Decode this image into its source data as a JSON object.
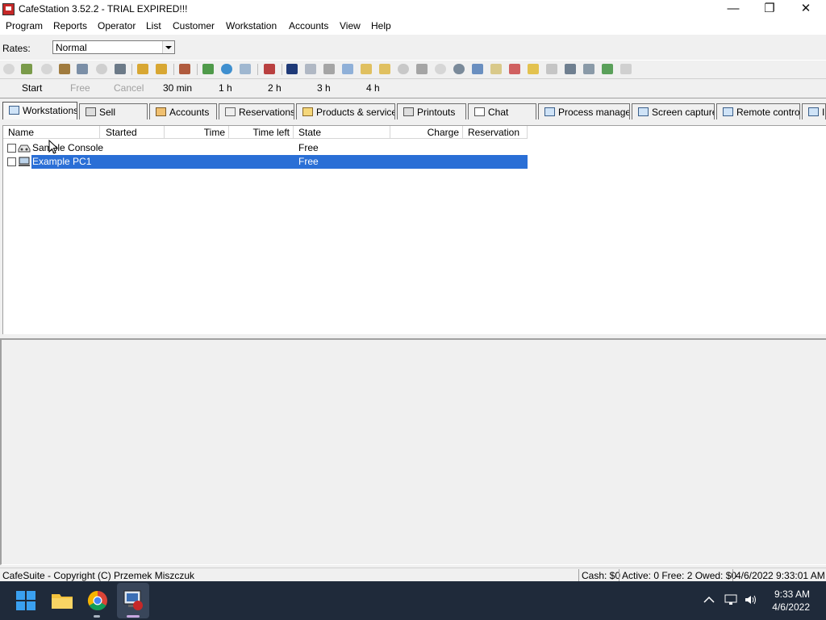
{
  "window": {
    "title": "CafeStation 3.52.2 - TRIAL EXPIRED!!!",
    "controls": [
      "—",
      "❐",
      "✕"
    ]
  },
  "menu": [
    "Program",
    "Reports",
    "Operator",
    "List",
    "Customer",
    "Workstation",
    "Accounts",
    "View",
    "Help"
  ],
  "rates": {
    "label": "Rates:",
    "value": "Normal"
  },
  "quick_actions": [
    {
      "label": "Start",
      "enabled": true
    },
    {
      "label": "Free",
      "enabled": false
    },
    {
      "label": "Cancel",
      "enabled": false
    },
    {
      "label": "30 min",
      "enabled": true
    },
    {
      "label": "1 h",
      "enabled": true
    },
    {
      "label": "2 h",
      "enabled": true
    },
    {
      "label": "3 h",
      "enabled": true
    },
    {
      "label": "4 h",
      "enabled": true
    }
  ],
  "tabs": [
    {
      "label": "Workstations",
      "active": true
    },
    {
      "label": "Sell"
    },
    {
      "label": "Accounts"
    },
    {
      "label": "Reservations"
    },
    {
      "label": "Products & services"
    },
    {
      "label": "Printouts"
    },
    {
      "label": "Chat"
    },
    {
      "label": "Process manager"
    },
    {
      "label": "Screen capture"
    },
    {
      "label": "Remote control"
    },
    {
      "label": "I"
    }
  ],
  "columns": [
    "Name",
    "Started",
    "Time",
    "Time left",
    "State",
    "Charge",
    "Reservation"
  ],
  "rows": [
    {
      "name": "Sample Console",
      "state": "Free",
      "selected": false
    },
    {
      "name": "Example PC1",
      "state": "Free",
      "selected": true
    }
  ],
  "status": {
    "copyright": "CafeSuite - Copyright (C) Przemek Miszczuk",
    "cash": "Cash: $0",
    "summary": "Active: 0 Free: 2 Owed: $0",
    "datetime": "4/6/2022 9:33:01 AM"
  },
  "taskbar": {
    "time": "9:33 AM",
    "date": "4/6/2022"
  }
}
